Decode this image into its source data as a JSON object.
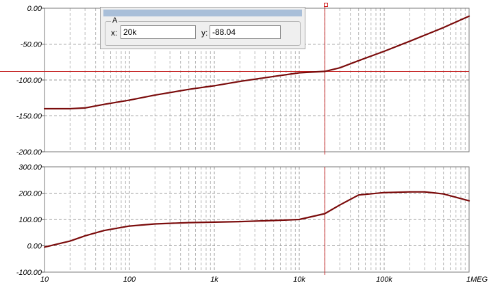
{
  "chart_data": [
    {
      "type": "line",
      "xscale": "log",
      "xlim": [
        10,
        1000000
      ],
      "ylim": [
        -200,
        0
      ],
      "yticks": [
        0,
        -50,
        -100,
        -150,
        -200
      ],
      "ytick_labels": [
        "0.00",
        "-50.00",
        "-100.00",
        "-150.00",
        "-200.00"
      ],
      "grid": true,
      "series": [
        {
          "color": "#7b0c0c",
          "x": [
            10,
            20,
            30,
            50,
            100,
            200,
            500,
            1000,
            2000,
            5000,
            10000,
            20000,
            30000,
            50000,
            100000,
            200000,
            500000,
            1000000
          ],
          "y": [
            -140,
            -140,
            -139,
            -134,
            -128,
            -121,
            -113,
            -108,
            -102,
            -95,
            -90,
            -88.04,
            -83,
            -73,
            -60,
            -46,
            -27,
            -11
          ]
        }
      ]
    },
    {
      "type": "line",
      "xscale": "log",
      "xlim": [
        10,
        1000000
      ],
      "ylim": [
        -100,
        300
      ],
      "yticks": [
        300,
        200,
        100,
        0,
        -100
      ],
      "ytick_labels": [
        "300.00",
        "200.00",
        "100.00",
        "0.00",
        "-100.00"
      ],
      "grid": true,
      "series": [
        {
          "color": "#7b0c0c",
          "x": [
            10,
            20,
            30,
            50,
            100,
            200,
            500,
            1000,
            2000,
            5000,
            10000,
            20000,
            30000,
            50000,
            100000,
            200000,
            300000,
            500000,
            1000000
          ],
          "y": [
            -5,
            18,
            38,
            58,
            75,
            83,
            88,
            90,
            92,
            96,
            100,
            122,
            155,
            193,
            202,
            205,
            205,
            197,
            171
          ]
        }
      ]
    }
  ],
  "x_axis": {
    "ticks": [
      10,
      100,
      1000,
      10000,
      100000,
      1000000
    ],
    "tick_labels": [
      "10",
      "100",
      "1k",
      "10k",
      "100k",
      "1MEG"
    ]
  },
  "cursor": {
    "panel_name": "A",
    "x_label": "x:",
    "y_label": "y:",
    "x_value": "20k",
    "y_value": "-88.04",
    "x_data": 20000,
    "y_data": -88.04,
    "color": "#c42020"
  }
}
